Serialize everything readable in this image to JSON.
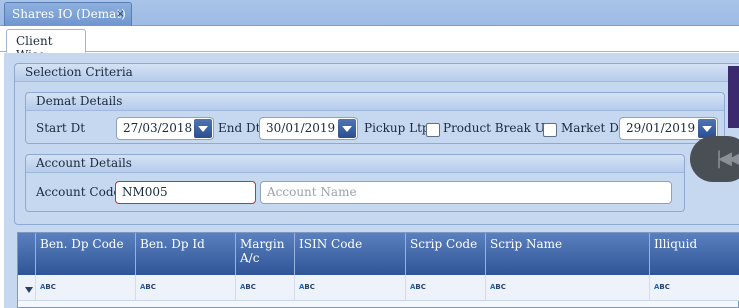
{
  "window": {
    "doc_tab_label": "Shares IO (Demat)",
    "close_glyph": "×"
  },
  "tabs": {
    "client_wise": "Client Wise"
  },
  "selection_criteria": {
    "title": "Selection Criteria",
    "demat_details": {
      "title": "Demat Details",
      "start_dt_label": "Start Dt",
      "start_dt_value": "27/03/2018",
      "end_dt_label": "End Dt",
      "end_dt_value": "30/01/2019",
      "pickup_ltp_label": "Pickup Ltp",
      "product_breakup_label": "Product Break Up",
      "market_dt_label": "Market Dt",
      "market_dt_value": "29/01/2019"
    },
    "account_details": {
      "title": "Account Details",
      "account_code_label": "Account Code",
      "account_code_value": "NM005",
      "account_name_placeholder": "Account Name"
    }
  },
  "grid": {
    "columns": [
      "Ben. Dp Code",
      "Ben. Dp Id",
      "Margin A/c",
      "ISIN Code",
      "Scrip Code",
      "Scrip Name",
      "Illiquid"
    ],
    "filter_icon": "funnel-icon",
    "filter_type_text_a": "A",
    "filter_type_text_bc": "BC"
  },
  "colors": {
    "header_blue": "#2f5597",
    "panel_bg": "#c6d8ef",
    "active_border": "#b33a3a"
  }
}
